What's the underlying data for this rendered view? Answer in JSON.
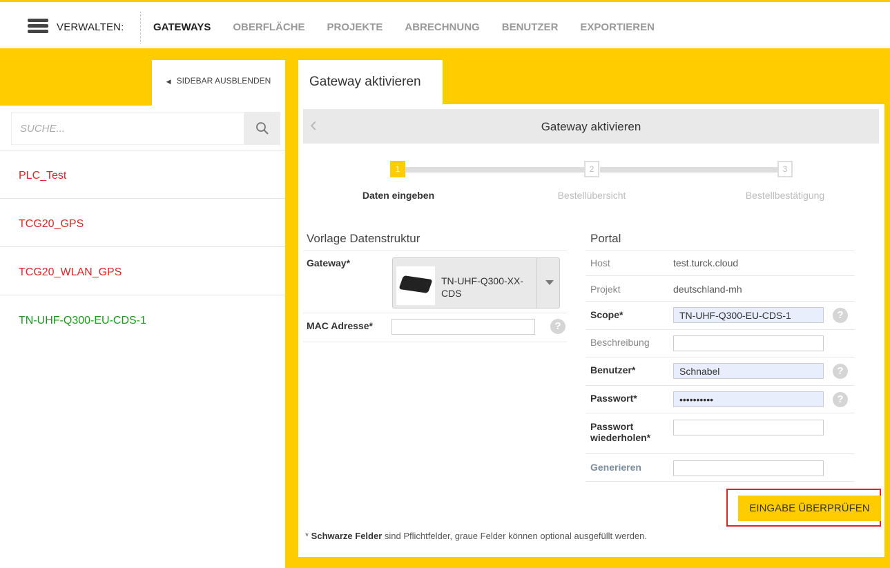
{
  "topbar": {
    "menu_label": "VERWALTEN:",
    "nav": [
      {
        "label": "GATEWAYS",
        "active": true
      },
      {
        "label": "OBERFLÄCHE",
        "active": false
      },
      {
        "label": "PROJEKTE",
        "active": false
      },
      {
        "label": "ABRECHNUNG",
        "active": false
      },
      {
        "label": "BENUTZER",
        "active": false
      },
      {
        "label": "EXPORTIEREN",
        "active": false
      }
    ]
  },
  "colors": {
    "accent": "#ffcc00",
    "error": "#e02424",
    "ok": "#1a9a1a"
  },
  "sidebar": {
    "toggle_label": "SIDEBAR AUSBLENDEN",
    "search_placeholder": "SUCHE...",
    "items": [
      {
        "label": "PLC_Test",
        "status": "red"
      },
      {
        "label": "TCG20_GPS",
        "status": "red"
      },
      {
        "label": "TCG20_WLAN_GPS",
        "status": "red"
      },
      {
        "label": "TN-UHF-Q300-EU-CDS-1",
        "status": "green"
      }
    ]
  },
  "main": {
    "tab_label": "Gateway aktivieren",
    "panel_title": "Gateway aktivieren",
    "steps": [
      {
        "num": "1",
        "label": "Daten eingeben",
        "active": true
      },
      {
        "num": "2",
        "label": "Bestellübersicht",
        "active": false
      },
      {
        "num": "3",
        "label": "Bestellbestätigung",
        "active": false
      }
    ],
    "left_form": {
      "title": "Vorlage Datenstruktur",
      "gateway_label": "Gateway*",
      "gateway_value": "TN-UHF-Q300-XX-CDS",
      "mac_label": "MAC Adresse*",
      "mac_value": ""
    },
    "portal": {
      "title": "Portal",
      "host_label": "Host",
      "host_value": "test.turck.cloud",
      "projekt_label": "Projekt",
      "projekt_value": "deutschland-mh",
      "scope_label": "Scope*",
      "scope_value": "TN-UHF-Q300-EU-CDS-1",
      "beschreibung_label": "Beschreibung",
      "beschreibung_value": "",
      "benutzer_label": "Benutzer*",
      "benutzer_value": "Schnabel",
      "passwort_label": "Passwort*",
      "passwort_value": "••••••••••",
      "passwort2_label_1": "Passwort",
      "passwort2_label_2": "wiederholen*",
      "passwort2_value": "",
      "generieren_label": "Generieren",
      "generieren_value": ""
    },
    "submit_label": "EINGABE ÜBERPRÜFEN",
    "footnote_bold": "Schwarze Felder",
    "footnote_prefix": "* ",
    "footnote_rest": " sind Pflichtfelder, graue Felder können optional ausgefüllt werden."
  }
}
